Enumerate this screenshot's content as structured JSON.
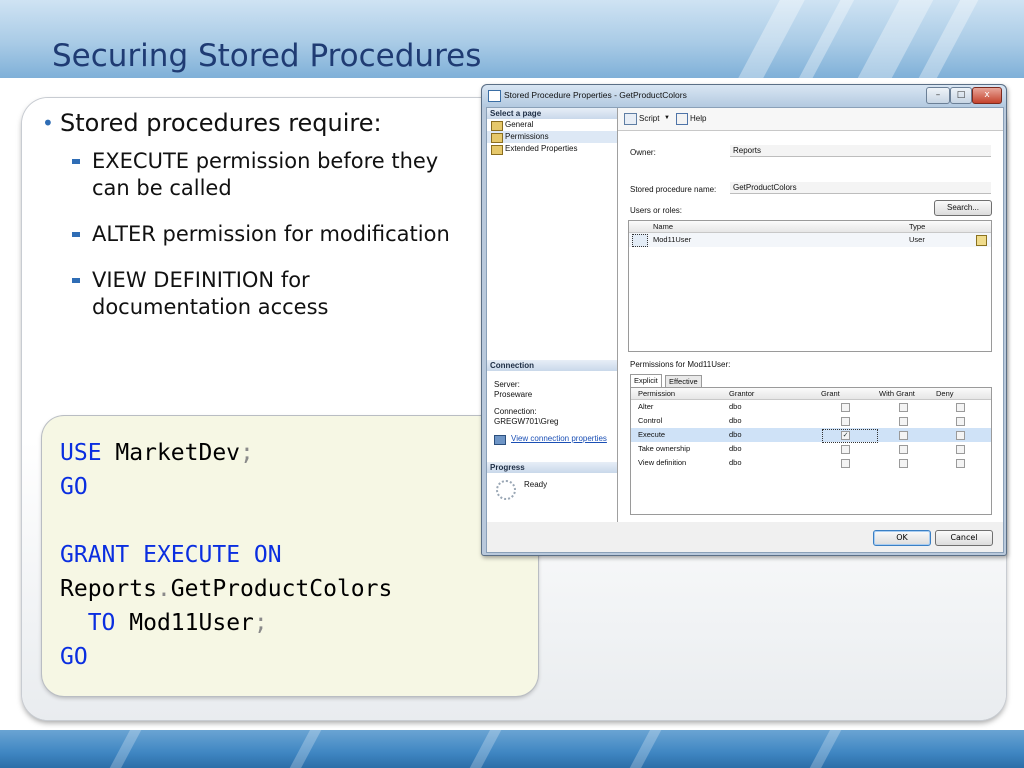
{
  "slide": {
    "title": "Securing Stored Procedures",
    "main_bullet": "Stored procedures require:",
    "sub_bullets": [
      "EXECUTE permission before they can be called",
      "ALTER permission for modification",
      "VIEW DEFINITION for documentation access"
    ],
    "code": {
      "line1_kw": "USE",
      "line1_obj": "MarketDev",
      "semi": ";",
      "go": "GO",
      "line3_kw1": "GRANT",
      "line3_kw2": "EXECUTE",
      "line3_kw3": "ON",
      "line4_schema": "Reports",
      "dot": ".",
      "line4_proc": "GetProductColors",
      "line5_kw": "TO",
      "line5_user": "Mod11User"
    }
  },
  "dialog": {
    "title": "Stored Procedure Properties - GetProductColors",
    "left": {
      "select_page_header": "Select a page",
      "pages": [
        "General",
        "Permissions",
        "Extended Properties"
      ],
      "connection_header": "Connection",
      "server_label": "Server:",
      "server_value": "Proseware",
      "connection_label": "Connection:",
      "connection_value": "GREGW701\\Greg",
      "view_connection_link": "View connection properties",
      "progress_header": "Progress",
      "progress_status": "Ready"
    },
    "toolbar": {
      "script_label": "Script",
      "help_label": "Help"
    },
    "owner_label": "Owner:",
    "owner_value": "Reports",
    "sp_name_label": "Stored procedure name:",
    "sp_name_value": "GetProductColors",
    "users_label": "Users or roles:",
    "search_button": "Search...",
    "users_grid": {
      "headers": [
        "Name",
        "Type"
      ],
      "rows": [
        {
          "name": "Mod11User",
          "type": "User"
        }
      ]
    },
    "permissions_for_label": "Permissions for Mod11User:",
    "tabs": [
      "Explicit",
      "Effective"
    ],
    "perm_grid": {
      "headers": [
        "Permission",
        "Grantor",
        "Grant",
        "With Grant",
        "Deny"
      ],
      "rows": [
        {
          "permission": "Alter",
          "grantor": "dbo",
          "grant": false,
          "with_grant": false,
          "deny": false
        },
        {
          "permission": "Control",
          "grantor": "dbo",
          "grant": false,
          "with_grant": false,
          "deny": false
        },
        {
          "permission": "Execute",
          "grantor": "dbo",
          "grant": true,
          "with_grant": false,
          "deny": false
        },
        {
          "permission": "Take ownership",
          "grantor": "dbo",
          "grant": false,
          "with_grant": false,
          "deny": false
        },
        {
          "permission": "View definition",
          "grantor": "dbo",
          "grant": false,
          "with_grant": false,
          "deny": false
        }
      ],
      "selected_row": 2
    },
    "ok_button": "OK",
    "cancel_button": "Cancel",
    "window_buttons": {
      "minimize": "–",
      "maximize": "□",
      "close": "x"
    }
  },
  "colors": {
    "title": "#1f3b73",
    "accent": "#2f6db5",
    "keyword": "#0a2ee0",
    "selection": "#cfe2f7"
  }
}
